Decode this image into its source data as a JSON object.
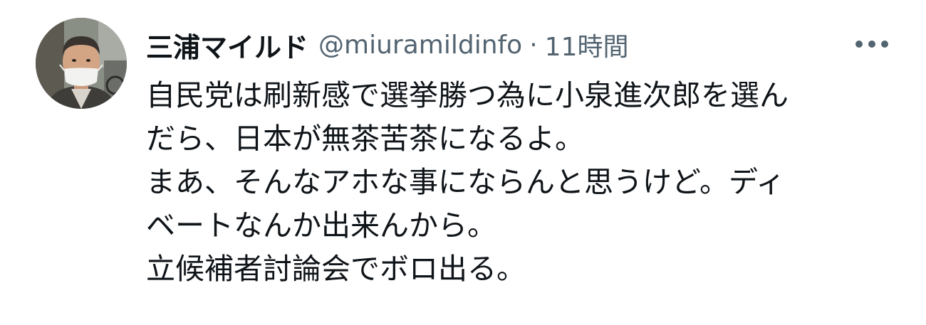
{
  "tweet": {
    "display_name": "三浦マイルド",
    "handle": "@miuramildinfo",
    "separator": "·",
    "timestamp": "11時間",
    "more_icon": "more-horizontal-icon",
    "lines": [
      "自民党は刷新感で選挙勝つ為に小泉進次郎を選ん",
      "だら、日本が無茶苦茶になるよ。",
      "まあ、そんなアホな事にならんと思うけど。ディ",
      "ベートなんか出来んから。",
      "立候補者討論会でボロ出る。"
    ]
  },
  "colors": {
    "text_primary": "#0f1419",
    "text_secondary": "#536471",
    "background": "#ffffff"
  }
}
